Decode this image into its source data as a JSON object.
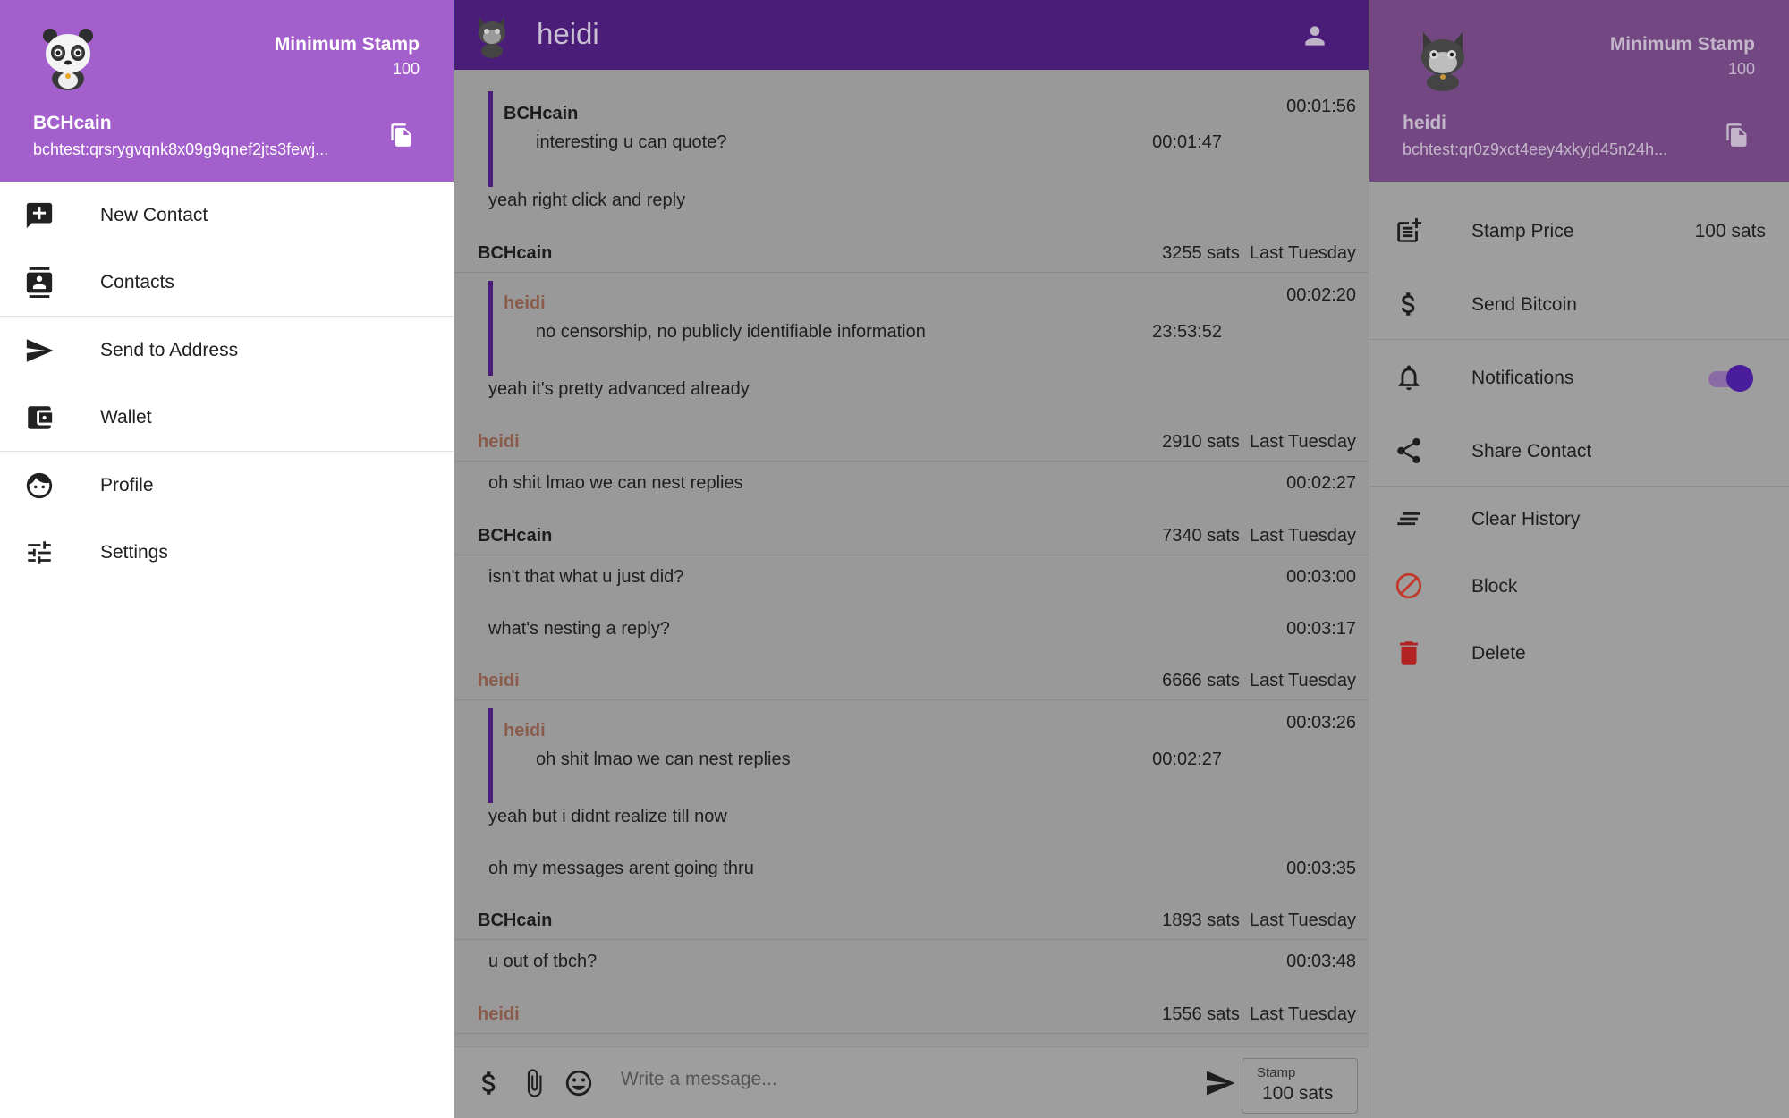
{
  "left_drawer": {
    "stamp_title": "Minimum Stamp",
    "stamp_value": "100",
    "name": "BCHcain",
    "address": "bchtest:qrsrygvqnk8x09g9qnef2jts3fewj...",
    "items": [
      {
        "label": "New Contact",
        "icon": "add-box-icon"
      },
      {
        "label": "Contacts",
        "icon": "contacts-icon"
      },
      {
        "label": "Send to Address",
        "icon": "send-icon"
      },
      {
        "label": "Wallet",
        "icon": "wallet-icon"
      },
      {
        "label": "Profile",
        "icon": "face-icon"
      },
      {
        "label": "Settings",
        "icon": "tune-icon"
      }
    ],
    "colors": {
      "header": "#a35fcb"
    }
  },
  "chat": {
    "contact_name": "heidi",
    "colors": {
      "header": "#4a1d78",
      "dim": "#999999",
      "quote_bar": "#4a1d78"
    },
    "messages": {
      "m1": {
        "quote_sender": "BCHcain",
        "quote_text": "interesting u can quote?",
        "quote_time": "00:01:47",
        "time": "00:01:56",
        "text": "yeah right click and reply"
      },
      "g2": {
        "sender": "BCHcain",
        "sats": "3255 sats",
        "day": "Last Tuesday"
      },
      "m2": {
        "quote_sender": "heidi",
        "quote_text": "no censorship, no publicly identifiable information",
        "quote_time": "23:53:52",
        "time": "00:02:20",
        "text": "yeah it's pretty advanced already"
      },
      "g3": {
        "sender": "heidi",
        "sats": "2910 sats",
        "day": "Last Tuesday"
      },
      "m3": {
        "text": "oh shit lmao we can nest replies",
        "time": "00:02:27"
      },
      "g4": {
        "sender": "BCHcain",
        "sats": "7340 sats",
        "day": "Last Tuesday"
      },
      "m4": {
        "text": "isn't that what u just did?",
        "time": "00:03:00"
      },
      "m5": {
        "text": "what's nesting a reply?",
        "time": "00:03:17"
      },
      "g5": {
        "sender": "heidi",
        "sats": "6666 sats",
        "day": "Last Tuesday"
      },
      "m6": {
        "quote_sender": "heidi",
        "quote_text": "oh shit lmao we can nest replies",
        "quote_time": "00:02:27",
        "time": "00:03:26",
        "text": "yeah but i didnt realize till now"
      },
      "m7": {
        "text": "oh my messages arent going thru",
        "time": "00:03:35"
      },
      "g6": {
        "sender": "BCHcain",
        "sats": "1893 sats",
        "day": "Last Tuesday"
      },
      "m8": {
        "text": "u out of tbch?",
        "time": "00:03:48"
      },
      "g7": {
        "sender": "heidi",
        "sats": "1556 sats",
        "day": "Last Tuesday"
      }
    },
    "composer": {
      "placeholder": "Write a message...",
      "stamp_label": "Stamp",
      "stamp_value": "100 sats"
    }
  },
  "right_drawer": {
    "stamp_title": "Minimum Stamp",
    "stamp_value": "100",
    "name": "heidi",
    "address": "bchtest:qr0z9xct4eey4xkyjd45n24h...",
    "items": [
      {
        "label": "Stamp Price",
        "value": "100 sats",
        "icon": "post-add-icon"
      },
      {
        "label": "Send Bitcoin",
        "icon": "dollar-icon"
      },
      {
        "label": "Notifications",
        "icon": "bell-icon",
        "enabled": true
      },
      {
        "label": "Share Contact",
        "icon": "share-icon"
      },
      {
        "label": "Clear History",
        "icon": "clear-all-icon"
      },
      {
        "label": "Block",
        "icon": "block-icon"
      },
      {
        "label": "Delete",
        "icon": "trash-icon"
      }
    ],
    "colors": {
      "header": "#734882",
      "block": "#c0392b",
      "delete": "#b22222",
      "toggle": "#4a1d9c"
    }
  }
}
